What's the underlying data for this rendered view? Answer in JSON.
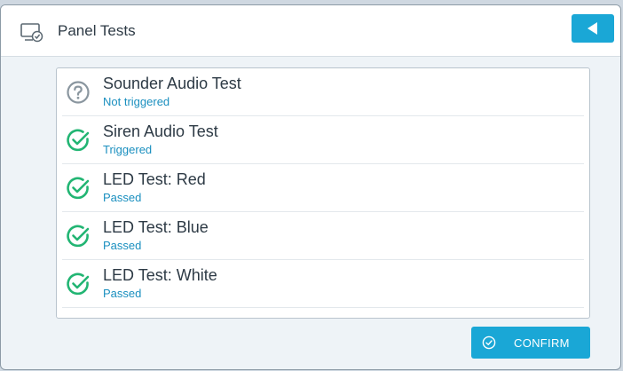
{
  "header": {
    "title": "Panel Tests",
    "icon": "monitor-check-icon",
    "back_icon": "back-arrow-icon"
  },
  "tests": [
    {
      "title": "Sounder Audio Test",
      "status": "Not triggered",
      "icon": "question-circle-icon"
    },
    {
      "title": "Siren Audio Test",
      "status": "Triggered",
      "icon": "check-circle-icon"
    },
    {
      "title": "LED Test: Red",
      "status": "Passed",
      "icon": "check-circle-icon"
    },
    {
      "title": "LED Test: Blue",
      "status": "Passed",
      "icon": "check-circle-icon"
    },
    {
      "title": "LED Test: White",
      "status": "Passed",
      "icon": "check-circle-icon"
    }
  ],
  "footer": {
    "confirm_label": "CONFIRM",
    "confirm_icon": "check-circle-icon"
  },
  "colors": {
    "accent": "#1aa7d6",
    "success": "#22b573",
    "neutral_icon": "#8a969f",
    "status_text": "#1a8fbf"
  }
}
